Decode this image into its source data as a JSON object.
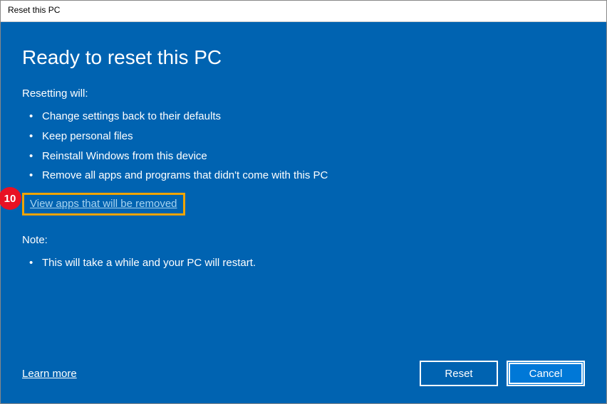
{
  "window": {
    "title": "Reset this PC"
  },
  "heading": "Ready to reset this PC",
  "resetting_label": "Resetting will:",
  "bullets": {
    "b0": "Change settings back to their defaults",
    "b1": "Keep personal files",
    "b2": "Reinstall Windows from this device",
    "b3": "Remove all apps and programs that didn't come with this PC"
  },
  "view_apps_link": "View apps that will be removed",
  "note_label": "Note:",
  "note_bullets": {
    "n0": "This will take a while and your PC will restart."
  },
  "learn_more": "Learn more",
  "buttons": {
    "reset": "Reset",
    "cancel": "Cancel"
  },
  "annotation": {
    "step_number": "10"
  }
}
